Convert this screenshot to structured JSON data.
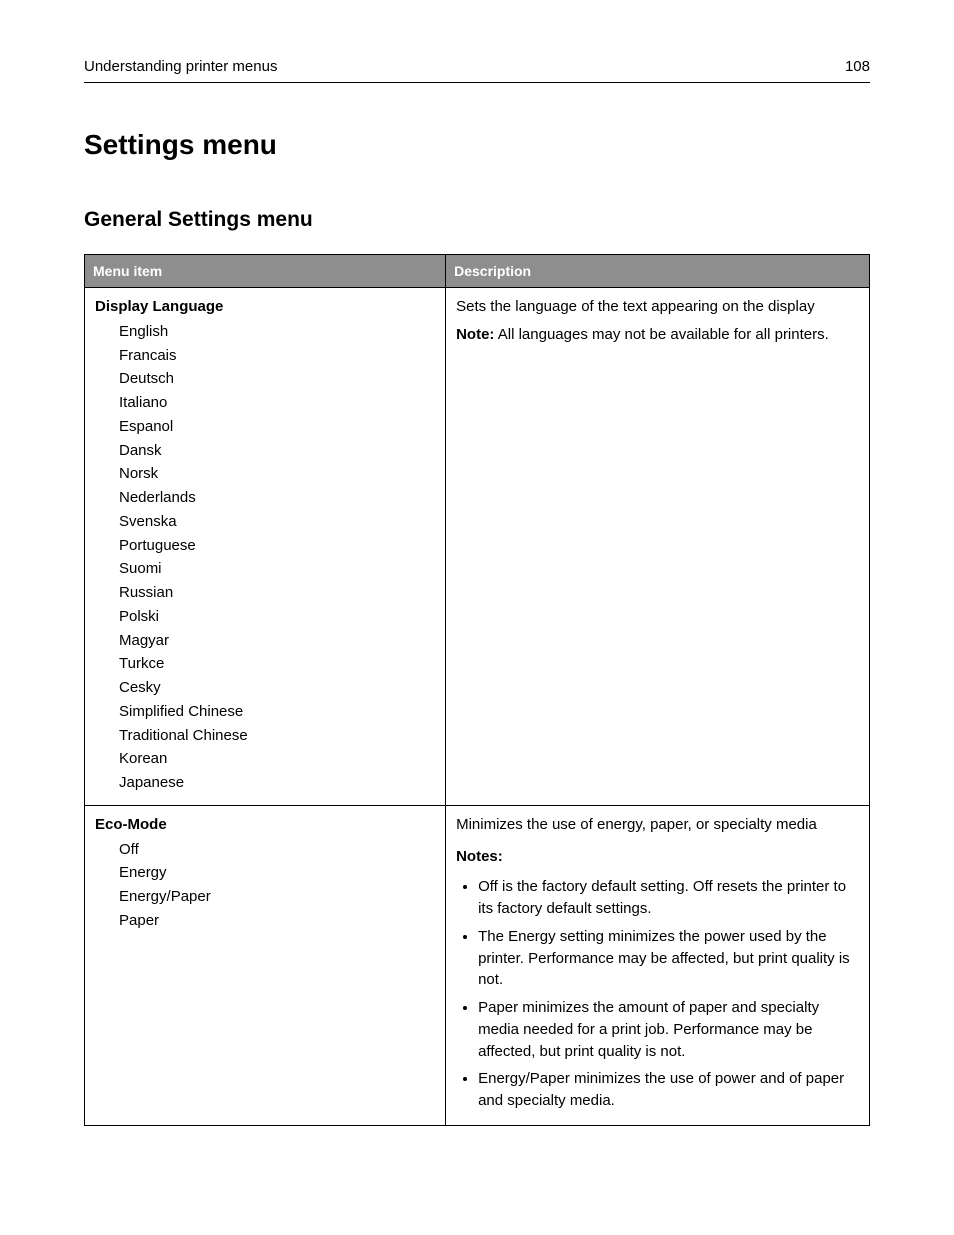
{
  "header": {
    "running_title": "Understanding printer menus",
    "page_number": "108"
  },
  "page_title": "Settings menu",
  "section_title": "General Settings menu",
  "table": {
    "headers": {
      "menu_item": "Menu item",
      "description": "Description"
    },
    "rows": [
      {
        "title": "Display Language",
        "options": [
          "English",
          "Francais",
          "Deutsch",
          "Italiano",
          "Espanol",
          "Dansk",
          "Norsk",
          "Nederlands",
          "Svenska",
          "Portuguese",
          "Suomi",
          "Russian",
          "Polski",
          "Magyar",
          "Turkce",
          "Cesky",
          "Simplified Chinese",
          "Traditional Chinese",
          "Korean",
          "Japanese"
        ],
        "desc_lead": "Sets the language of the text appearing on the display",
        "note_label": "Note:",
        "note_text": " All languages may not be available for all printers."
      },
      {
        "title": "Eco-Mode",
        "options": [
          "Off",
          "Energy",
          "Energy/Paper",
          "Paper"
        ],
        "desc_lead": "Minimizes the use of energy, paper, or specialty media",
        "notes_heading": "Notes:",
        "notes": [
          "Off is the factory default setting. Off resets the printer to its factory default settings.",
          "The Energy setting minimizes the power used by the printer. Performance may be affected, but print quality is not.",
          "Paper minimizes the amount of paper and specialty media needed for a print job. Performance may be affected, but print quality is not.",
          "Energy/Paper minimizes the use of power and of paper and specialty media."
        ]
      }
    ]
  }
}
